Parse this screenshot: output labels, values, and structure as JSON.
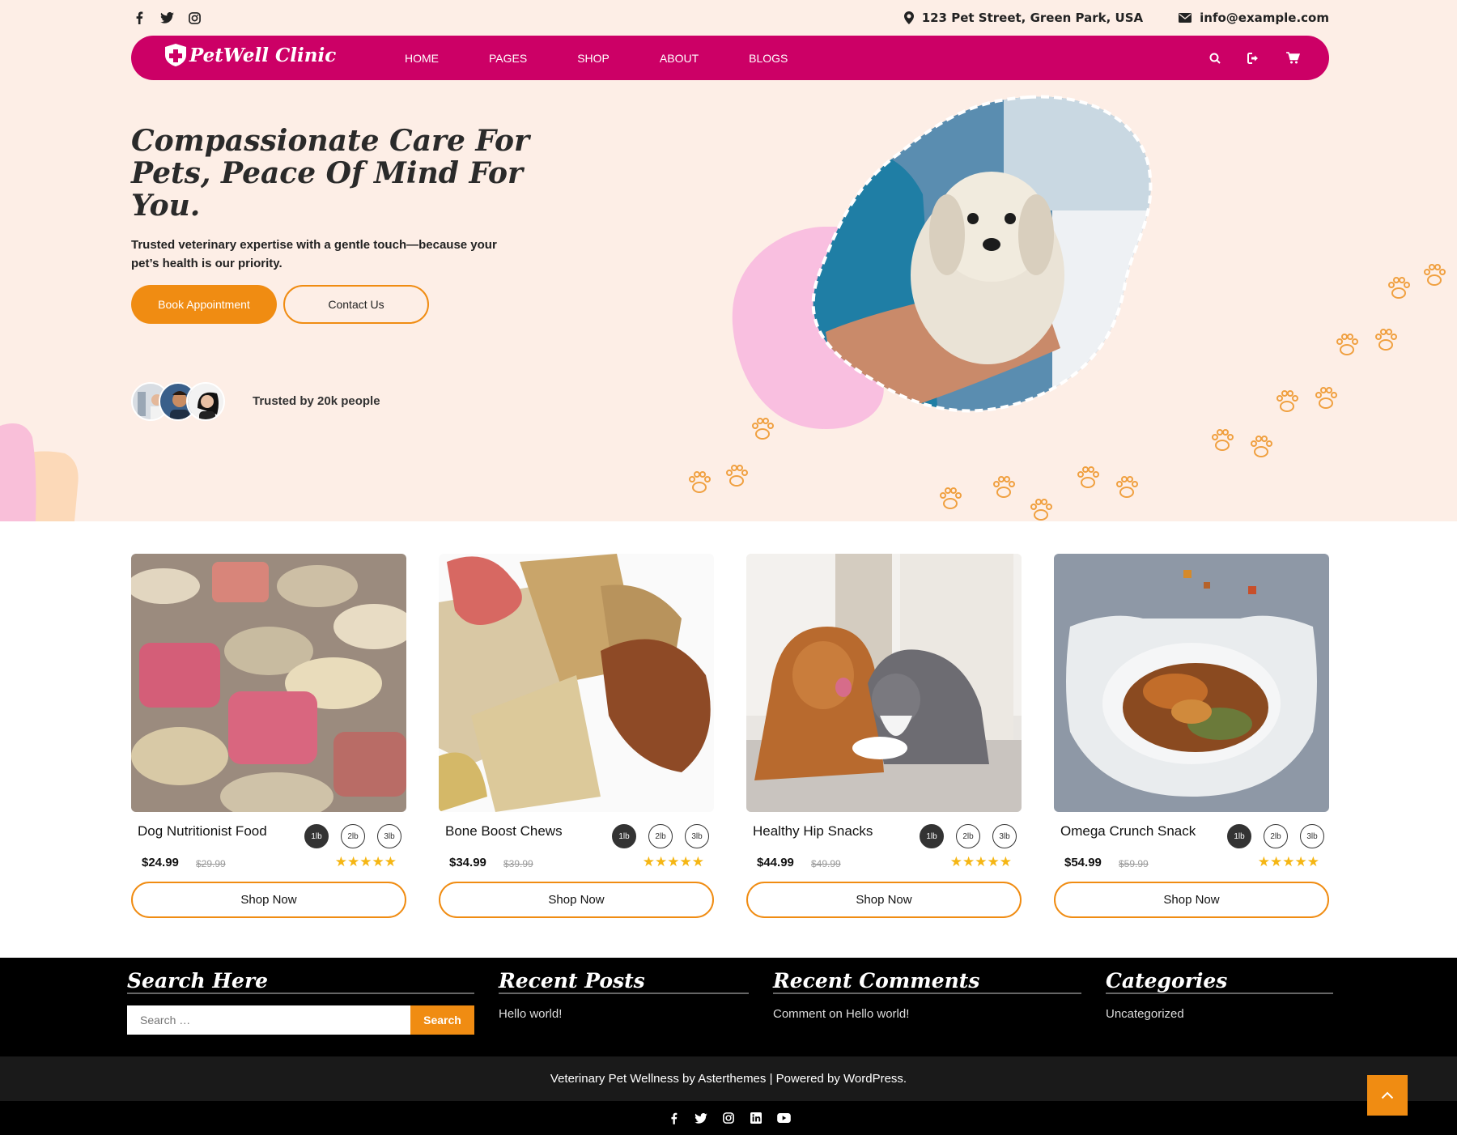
{
  "colors": {
    "brand": "#cc0066",
    "accent": "#f08c12",
    "hero_bg": "#fdeee6",
    "star": "#f5b614"
  },
  "topbar": {
    "social_icons": [
      "facebook-icon",
      "twitter-icon",
      "instagram-icon"
    ],
    "address": "123 Pet Street, Green Park, USA",
    "email": "info@example.com"
  },
  "nav": {
    "logo": "PetWell Clinic",
    "items": [
      "HOME",
      "PAGES",
      "SHOP",
      "ABOUT",
      "BLOGS"
    ],
    "icons": [
      "search-icon",
      "login-icon",
      "cart-icon"
    ]
  },
  "hero": {
    "title": "Compassionate Care For Pets, Peace Of Mind For You.",
    "subtitle": "Trusted veterinary expertise with a gentle touch—because your pet’s health is our priority.",
    "book_label": "Book Appointment",
    "contact_label": "Contact Us",
    "trusted": "Trusted by 20k people"
  },
  "products": [
    {
      "name": "Dog Nutritionist Food",
      "price": "$24.99",
      "old_price": "$29.99",
      "sizes": [
        "1lb",
        "2lb",
        "3lb"
      ],
      "rating": 5,
      "cta": "Shop Now"
    },
    {
      "name": "Bone Boost Chews",
      "price": "$34.99",
      "old_price": "$39.99",
      "sizes": [
        "1lb",
        "2lb",
        "3lb"
      ],
      "rating": 5,
      "cta": "Shop Now"
    },
    {
      "name": "Healthy Hip Snacks",
      "price": "$44.99",
      "old_price": "$49.99",
      "sizes": [
        "1lb",
        "2lb",
        "3lb"
      ],
      "rating": 5,
      "cta": "Shop Now"
    },
    {
      "name": "Omega Crunch Snack",
      "price": "$54.99",
      "old_price": "$59.99",
      "sizes": [
        "1lb",
        "2lb",
        "3lb"
      ],
      "rating": 5,
      "cta": "Shop Now"
    }
  ],
  "footer": {
    "search_title": "Search Here",
    "search_placeholder": "Search …",
    "search_button": "Search",
    "recent_posts_title": "Recent Posts",
    "recent_post": "Hello world!",
    "recent_comments_title": "Recent Comments",
    "recent_comment": "Comment on Hello world!",
    "categories_title": "Categories",
    "category": "Uncategorized",
    "copyright": "Veterinary Pet Wellness by Asterthemes | Powered by WordPress.",
    "social_icons": [
      "facebook-icon",
      "twitter-icon",
      "instagram-icon",
      "linkedin-icon",
      "youtube-icon"
    ]
  }
}
